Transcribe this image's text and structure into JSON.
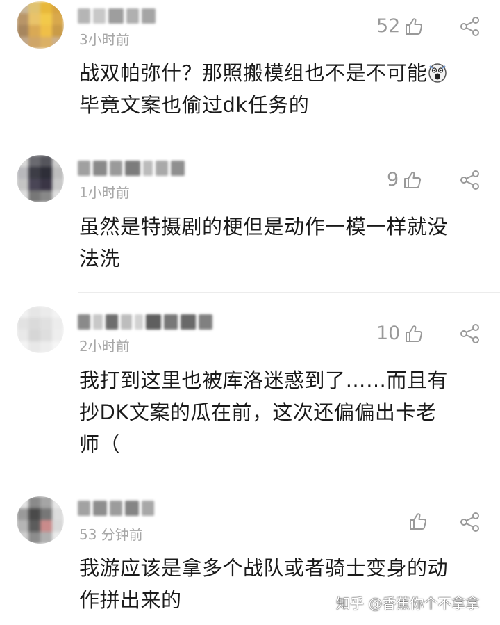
{
  "comments": [
    {
      "time": "3小时前",
      "likes": "52",
      "text": "战双帕弥什？那照搬模组也不是不可能",
      "text2": "毕竟文案也偷过dk任务的",
      "emoji": "scared-face-icon"
    },
    {
      "time": "1小时前",
      "likes": "9",
      "text": "虽然是特摄剧的梗但是动作一模一样就没",
      "text2": "法洗"
    },
    {
      "time": "2小时前",
      "likes": "10",
      "text": "我打到这里也被库洛迷惑到了……而且有",
      "text2": "抄DK文案的瓜在前，这次还偏偏出卡老",
      "text3": "师（"
    },
    {
      "time": "53 分钟前",
      "likes": "",
      "text": "我游应该是拿多个战队或者骑士变身的动",
      "text2": "作拼出来的"
    }
  ],
  "watermark": "知乎 @香蕉你个不拿拿",
  "colors": {
    "text": "#1a1a1a",
    "muted": "#a7a7a7",
    "icon": "#999999",
    "divider": "#ececec"
  }
}
